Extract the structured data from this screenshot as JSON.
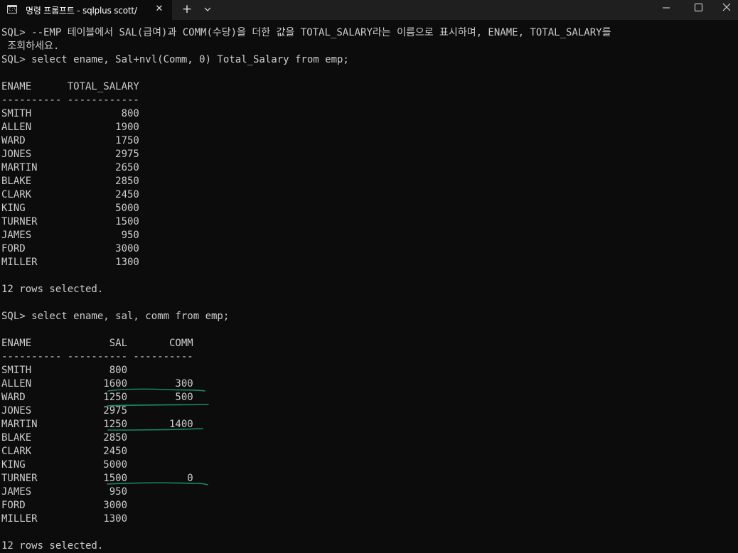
{
  "window": {
    "tab_title": "명령 프롬프트 - sqlplus  scott/",
    "tab_icon_glyph": "C:\\",
    "close_tab_symbol": "✕",
    "new_tab_symbol": "+",
    "icons": {
      "tab": "terminal-icon",
      "dropdown": "chevron-down-icon",
      "minimize": "minimize-icon",
      "maximize": "maximize-icon",
      "close": "close-icon"
    }
  },
  "colors": {
    "background": "#0c0c0c",
    "text": "#cccccc",
    "titlebar": "#1f1f1f",
    "annotation": "#1a8a6a"
  },
  "console": {
    "lines": [
      "SQL> --EMP 테이블에서 SAL(급여)과 COMM(수당)을 더한 값을 TOTAL_SALARY라는 이름으로 표시하며, ENAME, TOTAL_SALARY를",
      " 조회하세요.",
      "SQL> select ename, Sal+nvl(Comm, 0) Total_Salary from emp;",
      "",
      "ENAME      TOTAL_SALARY",
      "---------- ------------",
      "SMITH               800",
      "ALLEN              1900",
      "WARD               1750",
      "JONES              2975",
      "MARTIN             2650",
      "BLAKE              2850",
      "CLARK              2450",
      "KING               5000",
      "TURNER             1500",
      "JAMES               950",
      "FORD               3000",
      "MILLER             1300",
      "",
      "12 rows selected.",
      "",
      "SQL> select ename, sal, comm from emp;",
      "",
      "ENAME             SAL       COMM",
      "---------- ---------- ----------",
      "SMITH             800",
      "ALLEN            1600        300",
      "WARD             1250        500",
      "JONES            2975",
      "MARTIN           1250       1400",
      "BLAKE            2850",
      "CLARK            2450",
      "KING             5000",
      "TURNER           1500          0",
      "JAMES             950",
      "FORD             3000",
      "MILLER           1300",
      "",
      "12 rows selected."
    ]
  }
}
